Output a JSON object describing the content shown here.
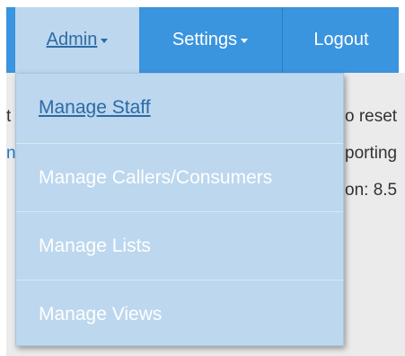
{
  "navbar": {
    "admin_label": "Admin",
    "settings_label": "Settings",
    "logout_label": "Logout"
  },
  "admin_menu": {
    "items": [
      {
        "label": "Manage Staff"
      },
      {
        "label": "Manage Callers/Consumers"
      },
      {
        "label": "Manage Lists"
      },
      {
        "label": "Manage Views"
      }
    ]
  },
  "background": {
    "left_fragments": [
      "t",
      "n"
    ],
    "right_fragments": [
      "o reset",
      "porting",
      "on: 8.5"
    ]
  },
  "colors": {
    "navbar": "#3a94de",
    "dropdown": "#bcd7ee",
    "active_link": "#2d6aa6"
  }
}
